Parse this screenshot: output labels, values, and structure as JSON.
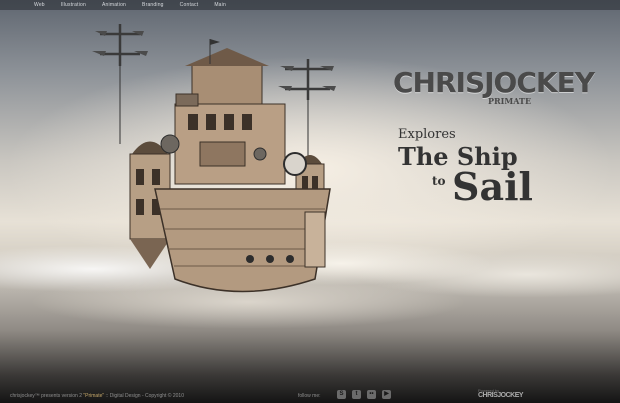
{
  "nav": {
    "items": [
      "Web",
      "Illustration",
      "Animation",
      "Branding",
      "Contact",
      "Main"
    ]
  },
  "brand": {
    "logo": "CHRISJOCKEY",
    "sub": "PRIMATE"
  },
  "headline": {
    "line1": "Explores",
    "line2": "The Ship",
    "line3": "to",
    "line4": "Sail"
  },
  "footer": {
    "copy_pre": "chrisjockey™ presents version 2 ",
    "copy_hl": "\"Primate\"",
    "copy_post": " :: Digital Design - Copyright © 2010",
    "follow": "follow me:",
    "social_icons": [
      "skype-icon",
      "twitter-icon",
      "flickr-icon",
      "youtube-icon"
    ],
    "byline": "Powered by",
    "byline_logo": "CHRISJOCKEY"
  },
  "colors": {
    "accent": "#c5a86a",
    "text_dark": "#333333",
    "logo": "#4a4a4a"
  }
}
